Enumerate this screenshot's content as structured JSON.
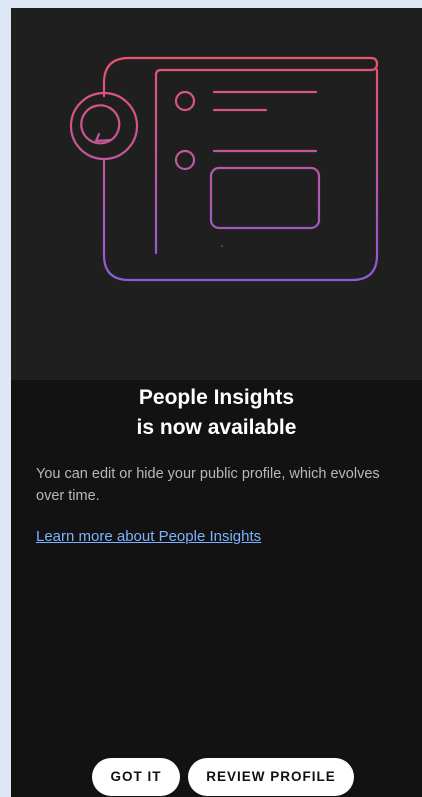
{
  "dialog": {
    "title_line1": "People Insights",
    "title_line2": "is now available",
    "description": "You can edit or hide your public profile, which evolves over time.",
    "learn_more_link": "Learn more about People Insights",
    "got_it_label": "GOT IT",
    "review_profile_label": "REVIEW PROFILE"
  },
  "illustration": {
    "icon_name": "profile-card-chat-illustration",
    "gradient_top_color": "#e8546c",
    "gradient_bottom_color": "#8e5bd8"
  },
  "colors": {
    "page_background": "#dce6f4",
    "dialog_background": "#121212",
    "hero_background": "#1f1f1f",
    "link_color": "#7cb2ff"
  }
}
